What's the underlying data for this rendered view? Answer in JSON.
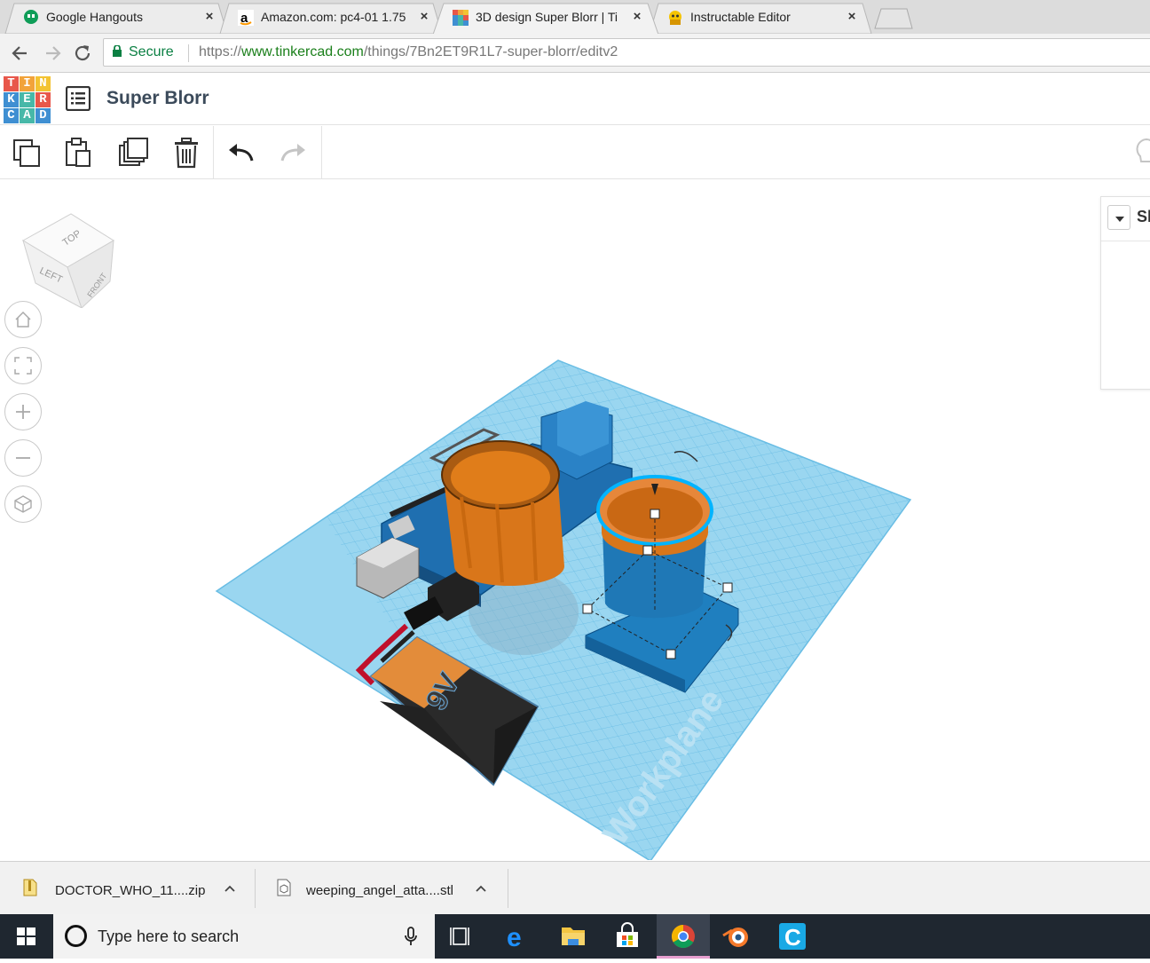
{
  "browser": {
    "tabs": [
      {
        "title": "Google Hangouts",
        "favicon": "hangouts-icon",
        "active": false
      },
      {
        "title": "Amazon.com: pc4-01 1.75",
        "favicon": "amazon-icon",
        "active": false
      },
      {
        "title": "3D design Super Blorr | Ti",
        "favicon": "tinkercad-icon",
        "active": true
      },
      {
        "title": "Instructable Editor",
        "favicon": "instructables-icon",
        "active": false
      }
    ],
    "close_glyph": "×",
    "secure_label": "Secure",
    "url_scheme": "https://",
    "url_host": "www.tinkercad.com",
    "url_path": "/things/7Bn2ET9R1L7-super-blorr/editv2"
  },
  "app": {
    "logo_letters": [
      "T",
      "I",
      "N",
      "K",
      "E",
      "R",
      "C",
      "A",
      "D"
    ],
    "logo_colors": [
      "#e8574a",
      "#f2a33a",
      "#f3c332",
      "#3f8fd2",
      "#47b8a8",
      "#e8574a",
      "#3f8fd2",
      "#47b8a8",
      "#3f8fd2"
    ],
    "design_title": "Super Blorr",
    "tools": [
      "copy-icon",
      "paste-icon",
      "duplicate-icon",
      "delete-icon",
      "undo-icon",
      "redo-icon"
    ]
  },
  "workspace": {
    "viewcube_faces": [
      "TOP",
      "LEFT",
      "FRONT"
    ],
    "view_controls": [
      "home-view-icon",
      "fit-view-icon",
      "zoom-in-icon",
      "zoom-out-icon",
      "ortho-view-icon"
    ],
    "workplane_label": "Workplane",
    "battery_label": "9V",
    "shape_panel_label": "Sh",
    "colors": {
      "grid": "#7fcbec",
      "cup": "#e07d1a",
      "blue_part": "#1f7fbf",
      "selection": "#00b4ff"
    }
  },
  "downloads": [
    {
      "name": "DOCTOR_WHO_11....zip",
      "icon": "zip-file-icon"
    },
    {
      "name": "weeping_angel_atta....stl",
      "icon": "stl-file-icon"
    }
  ],
  "taskbar": {
    "search_placeholder": "Type here to search",
    "apps": [
      "task-view-icon",
      "edge-icon",
      "file-explorer-icon",
      "store-icon",
      "chrome-icon",
      "blender-icon",
      "cura-icon"
    ]
  }
}
